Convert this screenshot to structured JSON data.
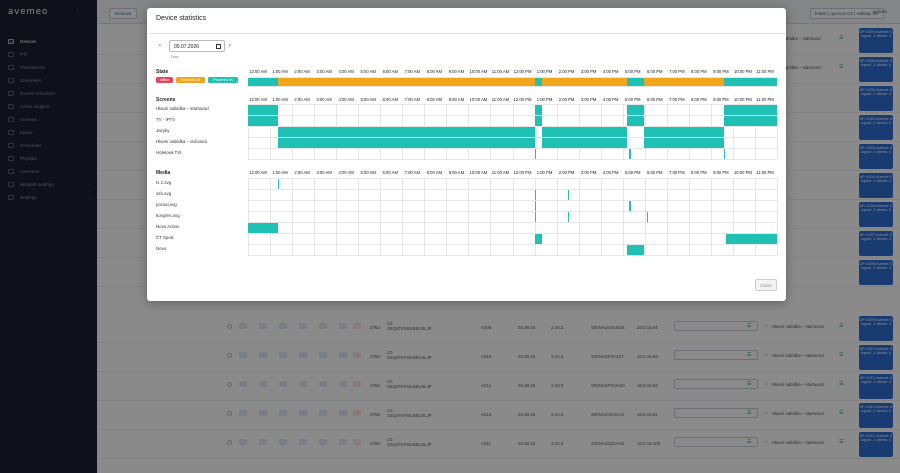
{
  "app": {
    "logo": "avemeo",
    "collapse_icon": "chevron-left-icon"
  },
  "sidebar": {
    "items": [
      {
        "label": "Devices",
        "icon": "devices-icon",
        "active": true
      },
      {
        "label": "PTI",
        "icon": "pti-icon"
      },
      {
        "label": "Translations",
        "icon": "translate-icon"
      },
      {
        "label": "Streamers",
        "icon": "stream-icon"
      },
      {
        "label": "Events scheduler",
        "icon": "calendar-icon"
      },
      {
        "label": "Active widgets",
        "icon": "widget-icon"
      },
      {
        "label": "Screens",
        "icon": "screen-icon"
      },
      {
        "label": "Media",
        "icon": "media-icon"
      },
      {
        "label": "Schedules",
        "icon": "schedule-icon"
      },
      {
        "label": "Playlists",
        "icon": "playlist-icon"
      },
      {
        "label": "Avemenu",
        "icon": "menu-icon"
      },
      {
        "label": "Widgets settings",
        "icon": "settings-icon",
        "chevron": true
      },
      {
        "label": "Settings",
        "icon": "gear-icon",
        "chevron": true
      }
    ]
  },
  "topbar": {
    "breadcrumb": "Devices",
    "filter": "hotels | quercus CZ | Holiday Inn",
    "user": "aplcato"
  },
  "background_rows": [
    {
      "id": "2762",
      "model": "LG",
      "serial": "SSQ4767H0LBEUSLJP",
      "room": "A209",
      "ver1": "03.38.15",
      "ver2": "2.10.3",
      "name": "SIGNAGSXU426",
      "ip": "10.0.15.94",
      "scenario": "Hlavní nabídka – startovací",
      "ap": "AP: A209 channel: 6 signal: -1 clients: 4"
    },
    {
      "id": "2763",
      "model": "LG",
      "serial": "SSQ4767H0LBEUSLJP",
      "room": "A210",
      "ver1": "03.38.15",
      "ver2": "2.10.3",
      "name": "SIGNAGPJA427",
      "ip": "10.0.15.93",
      "scenario": "Hlavní nabídka – startovací",
      "ap": "AP: A210 channel: 6 signal: -1 clients: 4"
    },
    {
      "id": "2764",
      "model": "LG",
      "serial": "SSQ4767H0LBEUSLJP",
      "room": "A212",
      "ver1": "03.38.15",
      "ver2": "2.10.3",
      "name": "SIGNAGPMJA20",
      "ip": "10.0.15.92",
      "scenario": "Hlavní nabídka – startovací",
      "ap": "AP: A212 channel: 6 signal: -1 clients: 4"
    },
    {
      "id": "2765",
      "model": "LG",
      "serial": "SSQ4767H0LBEUSLJP",
      "room": "A213",
      "ver1": "03.38.15",
      "ver2": "2.10.3",
      "name": "SIGNAGSXJ4A4",
      "ip": "10.0.15.91",
      "scenario": "Hlavní nabídka – startovací",
      "ap": "AP: A213 channel: 6 signal: -1 clients: 4"
    },
    {
      "id": "2766",
      "model": "LG",
      "serial": "SSQ4767H0LBEUSLJP",
      "room": "A211",
      "ver1": "03.38.15",
      "ver2": "2.10.3",
      "name": "SIGNAGQSJA24",
      "ip": "10.0.15.100",
      "scenario": "Hlavní nabídka – startovací",
      "ap": "AP: A211 channel: 6 signal: -1 clients: 4"
    }
  ],
  "background_top_rows": [
    {
      "scenario": "Hlavní nabídka – startovací",
      "ap": "AP: A205 channel: 6 signal: -1 clients: 4"
    },
    {
      "scenario": "Hlavní nabídka – startovací",
      "ap": "AP: A206 channel: 6 signal: -1 clients: 4"
    },
    {
      "scenario": "",
      "ap": "AP: A200 channel: 6 signal: -1 clients: 4"
    },
    {
      "scenario": "",
      "ap": "AP: A203 channel: 6 signal: -1 clients: 4"
    },
    {
      "scenario": "",
      "ap": "AP: A204 channel: 6 signal: -1 clients: 4"
    },
    {
      "scenario": "",
      "ap": "AP: A205 channel: 6 signal: -1 clients: 4"
    },
    {
      "scenario": "",
      "ap": "AP: A206 channel: 6 signal: -1 clients: 4"
    },
    {
      "scenario": "",
      "ap": "AP: A207 channel: 6 signal: -1 clients: 4"
    },
    {
      "scenario": "",
      "ap": "AP: A208 channel: 6 signal: -1 clients: 4"
    }
  ],
  "modal": {
    "title": "Device statistics",
    "date": "05.07.2026",
    "date_caption": "Date",
    "close_label": "Close",
    "hours": [
      "12:00 AM",
      "1:00 AM",
      "2:00 AM",
      "3:00 AM",
      "4:00 AM",
      "5:00 AM",
      "6:00 AM",
      "7:00 AM",
      "8:00 AM",
      "9:00 AM",
      "10:00 AM",
      "11:00 AM",
      "12:00 PM",
      "1:00 PM",
      "2:00 PM",
      "3:00 PM",
      "4:00 PM",
      "5:00 PM",
      "6:00 PM",
      "7:00 PM",
      "8:00 PM",
      "9:00 PM",
      "10:00 PM",
      "11:00 PM"
    ],
    "colors": {
      "teal": "#1fc1b4",
      "orange": "#f2a51a",
      "red": "#e8455a"
    },
    "state": {
      "title": "State",
      "badges": [
        {
          "label": "offline",
          "color": "#e8455a"
        },
        {
          "label": "Powered off",
          "color": "#f2a51a"
        },
        {
          "label": "Powered on",
          "color": "#1fc1b4"
        }
      ],
      "segments": [
        {
          "start": 0,
          "end": 1.35,
          "status": "Powered on"
        },
        {
          "start": 1.35,
          "end": 13.0,
          "status": "Powered off"
        },
        {
          "start": 13.0,
          "end": 13.35,
          "status": "Powered on"
        },
        {
          "start": 13.35,
          "end": 17.2,
          "status": "Powered off"
        },
        {
          "start": 17.2,
          "end": 17.95,
          "status": "Powered on"
        },
        {
          "start": 17.95,
          "end": 21.6,
          "status": "Powered off"
        },
        {
          "start": 21.6,
          "end": 24,
          "status": "Powered on"
        }
      ]
    },
    "screens": {
      "title": "Screens",
      "rows": [
        {
          "label": "Hlavní nabídka – startovací",
          "segments": [
            [
              0,
              1.35
            ],
            [
              13.0,
              13.35
            ],
            [
              17.2,
              17.95
            ],
            [
              21.6,
              24
            ]
          ]
        },
        {
          "label": "TV - IPTV",
          "segments": [
            [
              0,
              1.35
            ],
            [
              13.0,
              13.35
            ],
            [
              17.2,
              17.95
            ],
            [
              21.6,
              24
            ]
          ]
        },
        {
          "label": "Jazyky",
          "segments": [
            [
              1.35,
              13.0
            ],
            [
              13.35,
              17.2
            ],
            [
              17.95,
              21.6
            ]
          ]
        },
        {
          "label": "Hlavní nabídka – dočasná",
          "segments": [
            [
              1.35,
              13.0
            ],
            [
              13.35,
              17.2
            ],
            [
              17.95,
              21.6
            ]
          ]
        },
        {
          "label": "Hotelová TVI",
          "segments": [
            [
              13.0,
              13.06
            ],
            [
              17.3,
              17.36
            ],
            [
              21.6,
              21.66
            ]
          ]
        }
      ]
    },
    "media": {
      "title": "Media",
      "rows": [
        {
          "label": "tv 1.svg",
          "segments": [
            [
              1.35,
              1.42
            ]
          ]
        },
        {
          "label": "info.svg",
          "segments": [
            [
              13.0,
              13.06
            ],
            [
              14.5,
              14.56
            ]
          ]
        },
        {
          "label": "pocasi.svg",
          "segments": [
            [
              13.0,
              13.06
            ],
            [
              17.3,
              17.36
            ]
          ]
        },
        {
          "label": "kongres.svg",
          "segments": [
            [
              13.0,
              13.06
            ],
            [
              14.5,
              14.56
            ],
            [
              18.1,
              18.16
            ]
          ]
        },
        {
          "label": "Novo Action",
          "segments": [
            [
              0,
              1.35
            ]
          ]
        },
        {
          "label": "ČT Sport",
          "segments": [
            [
              13.0,
              13.35
            ],
            [
              21.7,
              24
            ]
          ]
        },
        {
          "label": "Novo",
          "segments": [
            [
              17.2,
              17.95
            ]
          ]
        }
      ]
    }
  }
}
